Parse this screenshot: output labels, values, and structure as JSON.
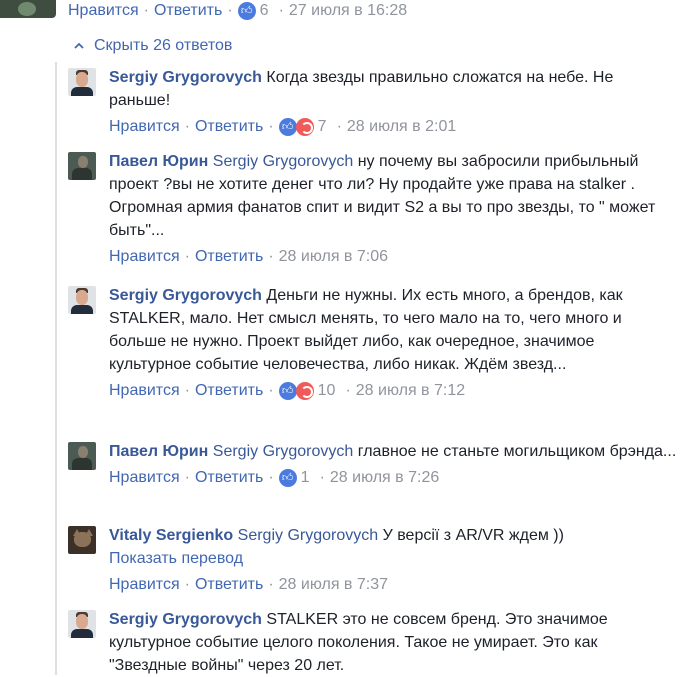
{
  "top_actions": {
    "like": "Нравится",
    "reply": "Ответить",
    "reactions": "6",
    "time": "27 июля в 16:28"
  },
  "hide_replies": "Скрыть 26 ответов",
  "comments": [
    {
      "author": "Sergiy Grygorovych",
      "mention": "",
      "text": "Когда звезды правильно сложатся на небе. Не раньше!",
      "like": "Нравится",
      "reply": "Ответить",
      "reactions": "7",
      "time": "28 июля в 2:01"
    },
    {
      "author": "Павел Юрин",
      "mention": "Sergiy Grygorovych",
      "text": "ну почему вы забросили прибыльный проект ?вы не хотите денег что ли? Ну продайте уже права на stalker . Огромная армия фанатов спит и видит S2 а вы то про звезды, то \" может быть\"...",
      "like": "Нравится",
      "reply": "Ответить",
      "reactions": "",
      "time": "28 июля в 7:06"
    },
    {
      "author": "Sergiy Grygorovych",
      "mention": "",
      "text": "Деньги не нужны. Их есть много, а брендов, как STALKER, мало. Нет смысл менять, то чего мало на то, чего много и больше не нужно. Проект выйдет либо, как очередное, значимое культурное событие человечества, либо никак. Ждём звезд...",
      "like": "Нравится",
      "reply": "Ответить",
      "reactions": "10",
      "time": "28 июля в 7:12"
    },
    {
      "author": "Павел Юрин",
      "mention": "Sergiy Grygorovych",
      "text": "главное не станьте могильщиком брэнда...",
      "like": "Нравится",
      "reply": "Ответить",
      "reactions": "1",
      "time": "28 июля в 7:26"
    },
    {
      "author": "Vitaly Sergienko",
      "mention": "Sergiy Grygorovych",
      "text": "У версії з AR/VR ждем ))",
      "translate": "Показать перевод",
      "like": "Нравится",
      "reply": "Ответить",
      "reactions": "",
      "time": "28 июля в 7:37"
    },
    {
      "author": "Sergiy Grygorovych",
      "mention": "",
      "text": "STALKER это не совсем бренд. Это значимое культурное событие целого поколения. Такое не умирает. Это как \"Звездные войны\" через 20 лет."
    }
  ]
}
